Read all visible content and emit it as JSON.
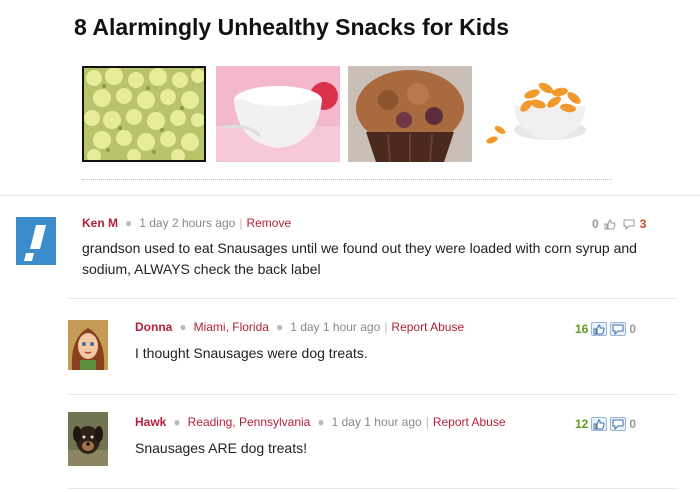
{
  "article": {
    "title": "8 Alarmingly Unhealthy Snacks for Kids",
    "thumbnails": [
      {
        "name": "popcorn-thumbnail"
      },
      {
        "name": "yogurt-thumbnail"
      },
      {
        "name": "muffin-thumbnail"
      },
      {
        "name": "cheese-puffs-thumbnail"
      }
    ]
  },
  "comments": [
    {
      "author": "Ken M",
      "location": "",
      "time": "1 day 2 hours ago",
      "action": "Remove",
      "text": "grandson used to eat Snausages until we found out they were loaded with corn syrup and sodium, ALWAYS check the back label",
      "likes": "0",
      "dislikes": "3",
      "avatar": "default-avatar-icon"
    },
    {
      "author": "Donna",
      "location": "Miami, Florida",
      "time": "1 day 1 hour ago",
      "action": "Report Abuse",
      "text": "I thought Snausages were dog treats.",
      "likes": "16",
      "dislikes": "0",
      "avatar": "cartoon-woman-avatar"
    },
    {
      "author": "Hawk",
      "location": "Reading, Pennsylvania",
      "time": "1 day 1 hour ago",
      "action": "Report Abuse",
      "text": "Snausages ARE dog treats!",
      "likes": "12",
      "dislikes": "0",
      "avatar": "dog-photo-avatar"
    }
  ],
  "colors": {
    "author": "#b41f3c",
    "likes_positive": "#5a9e1b",
    "dislikes_positive": "#d0451b",
    "avatar_blue": "#3a8ccd"
  }
}
